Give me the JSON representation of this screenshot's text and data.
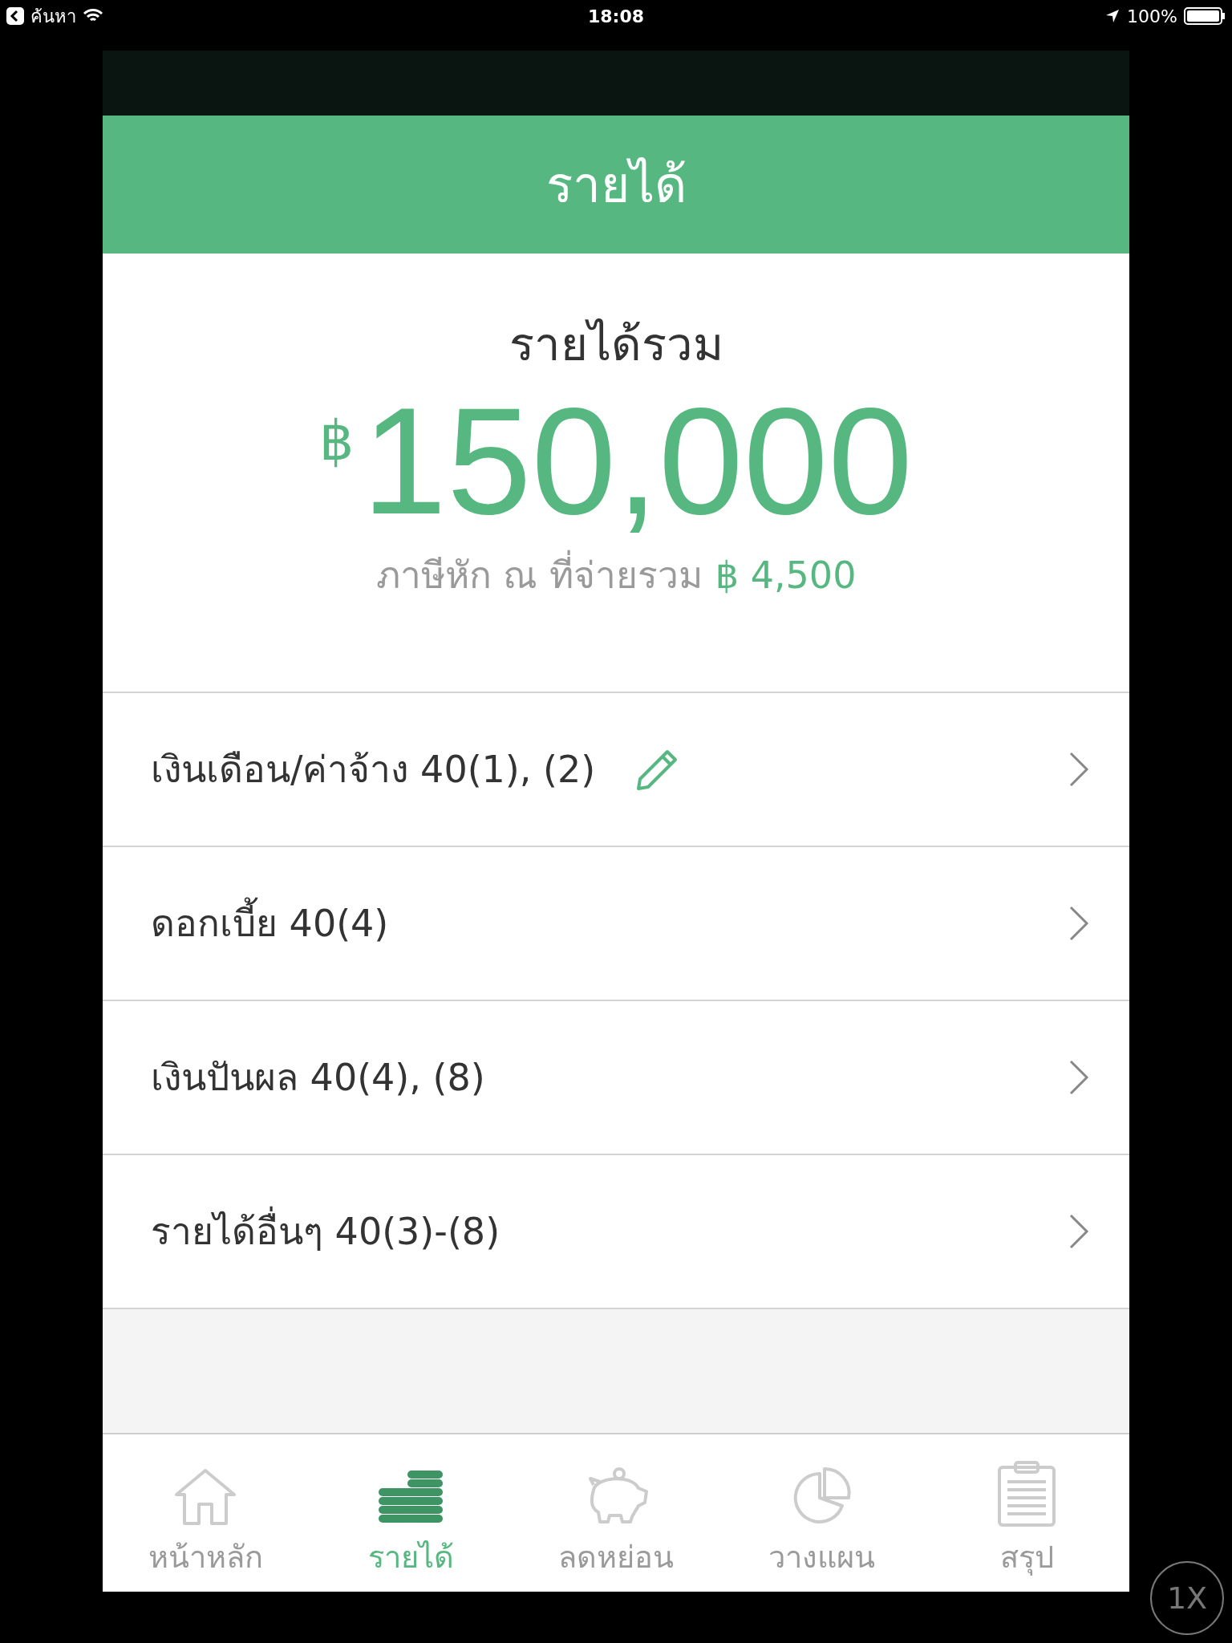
{
  "status_bar": {
    "back_label": "ค้นหา",
    "time": "18:08",
    "battery": "100%"
  },
  "header": {
    "title": "รายได้"
  },
  "summary": {
    "title": "รายได้รวม",
    "currency": "฿",
    "amount": "150,000",
    "tax_label": "ภาษีหัก ณ ที่จ่ายรวม",
    "tax_amount": "฿ 4,500"
  },
  "rows": [
    {
      "label": "เงินเดือน/ค่าจ้าง 40(1), (2)",
      "editable": true
    },
    {
      "label": "ดอกเบี้ย 40(4)",
      "editable": false
    },
    {
      "label": "เงินปันผล 40(4), (8)",
      "editable": false
    },
    {
      "label": "รายได้อื่นๆ 40(3)-(8)",
      "editable": false
    }
  ],
  "tabs": [
    {
      "label": "หน้าหลัก",
      "kind": "home",
      "selected": false
    },
    {
      "label": "รายได้",
      "kind": "coins",
      "selected": true
    },
    {
      "label": "ลดหย่อน",
      "kind": "piggy",
      "selected": false
    },
    {
      "label": "วางแผน",
      "kind": "pie",
      "selected": false
    },
    {
      "label": "สรุป",
      "kind": "clipboard",
      "selected": false
    }
  ],
  "zoom_button": "1X"
}
